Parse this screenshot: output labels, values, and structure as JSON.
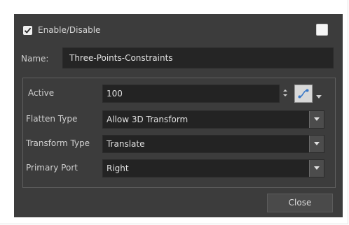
{
  "dialog": {
    "enable_checkbox": {
      "label": "Enable/Disable",
      "checked": true
    },
    "color_swatch": {
      "color": "#f6f6f6"
    },
    "name": {
      "label": "Name:",
      "value": "Three-Points-Constraints"
    },
    "rows": {
      "active": {
        "label": "Active",
        "value": "100",
        "icon": "function-curve-icon"
      },
      "flatten_type": {
        "label": "Flatten Type",
        "value": "Allow 3D Transform"
      },
      "transform_type": {
        "label": "Transform Type",
        "value": "Translate"
      },
      "primary_port": {
        "label": "Primary Port",
        "value": "Right"
      }
    },
    "close_button": {
      "label": "Close"
    }
  },
  "colors": {
    "dialog_bg": "#3c3c3c",
    "field_bg": "#232323",
    "accent": "#3a79c8"
  }
}
